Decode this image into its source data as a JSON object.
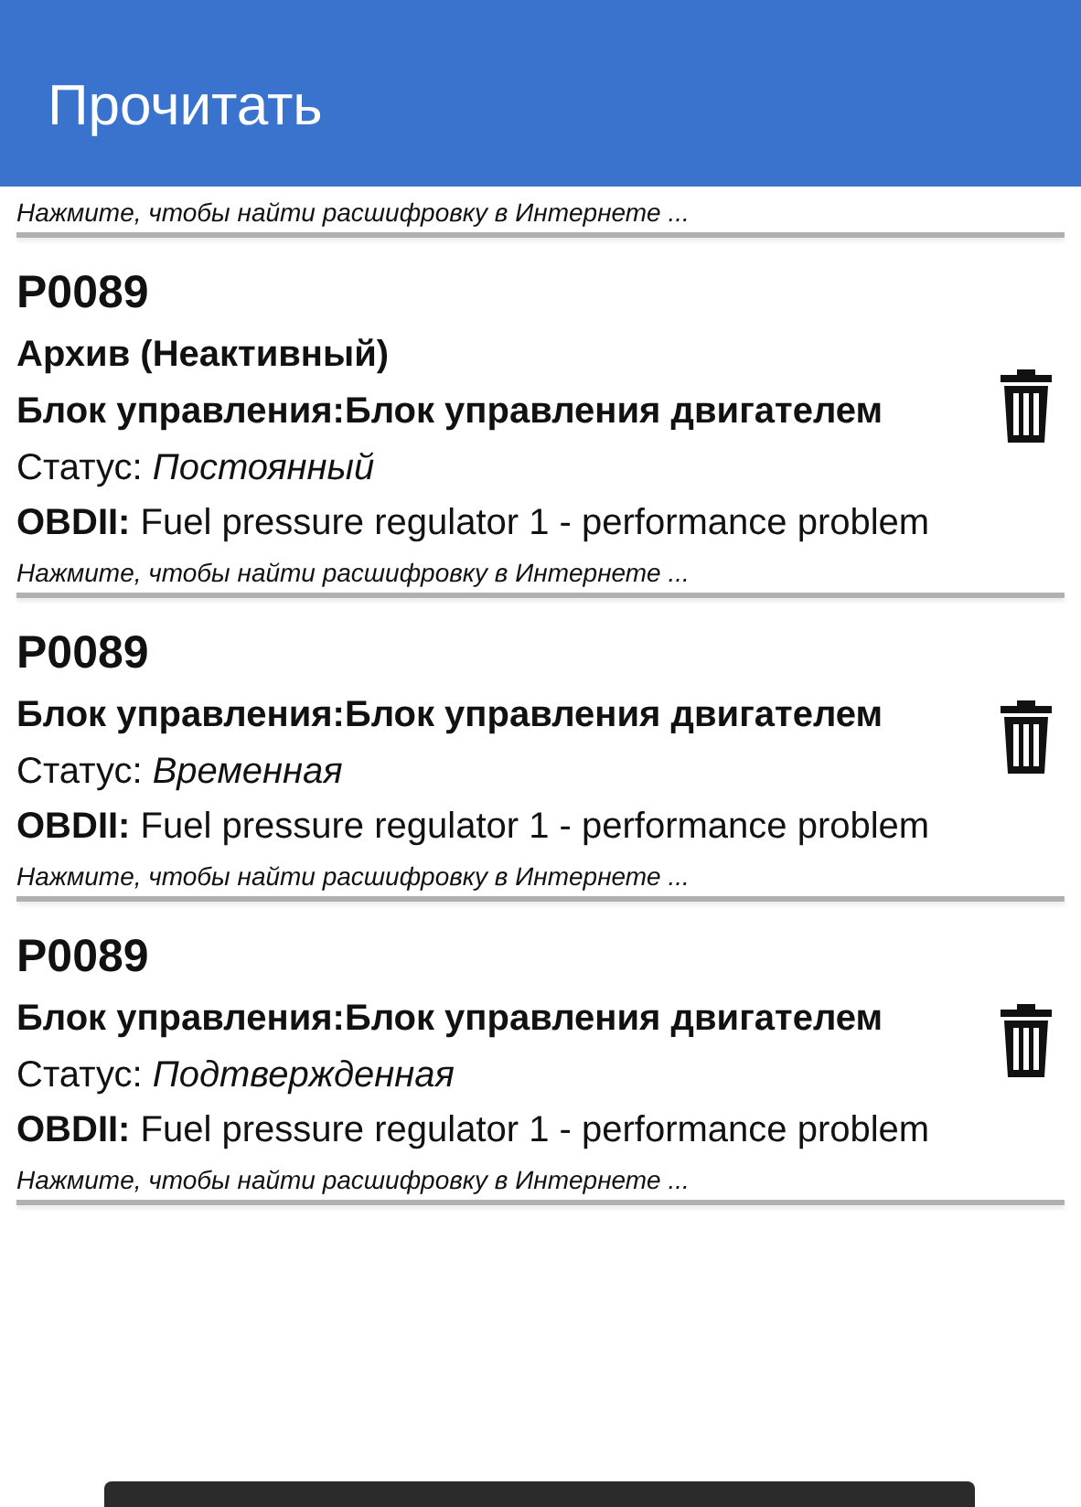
{
  "app_bar": {
    "title": "Прочитать"
  },
  "top_hint": "Нажмите, чтобы найти расшифровку в Интернете ...",
  "codes": [
    {
      "code": "P0089",
      "archive": "Архив (Неактивный)",
      "module": "Блок управления:Блок управления двигателем",
      "status": "Статус: *Постоянный*",
      "description": "**OBDII:** Fuel pressure regulator 1 - performance problem",
      "hint": "Нажмите, чтобы найти расшифровку в Интернете ..."
    },
    {
      "code": "P0089",
      "module": "Блок управления:Блок управления двигателем",
      "status": "Статус: *Временная*",
      "description": "**OBDII:** Fuel pressure regulator 1 - performance problem",
      "hint": "Нажмите, чтобы найти расшифровку в Интернете ..."
    },
    {
      "code": "P0089",
      "module": "Блок управления:Блок управления двигателем",
      "status": "Статус: *Подтвержденная*",
      "description": "**OBDII:** Fuel pressure regulator 1 - performance problem",
      "hint": "Нажмите, чтобы найти расшифровку в Интернете ..."
    }
  ],
  "snackbar": {
    "kind": "snackbar"
  }
}
